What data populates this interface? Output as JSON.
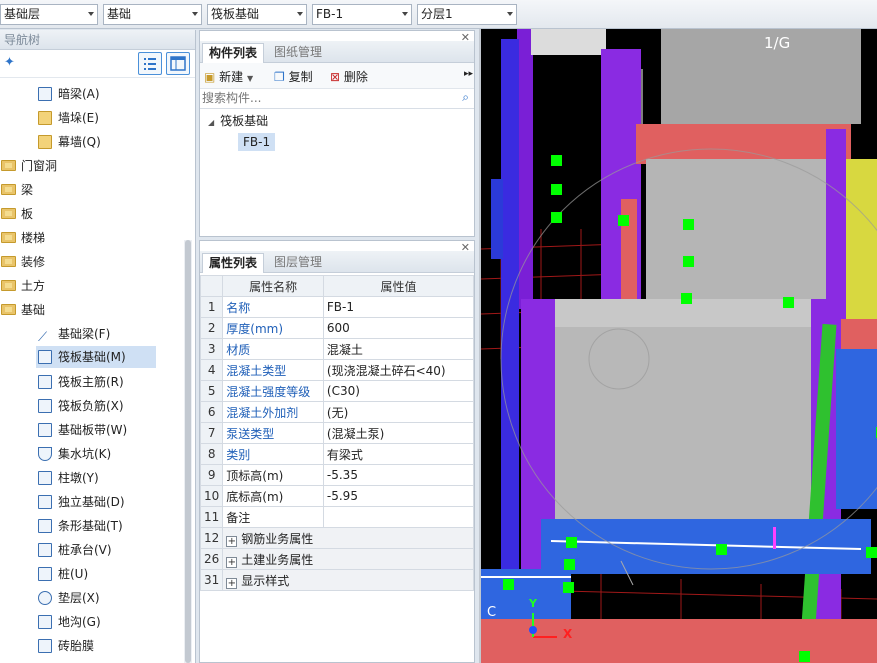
{
  "toolbar": {
    "floor": "基础层",
    "category": "基础",
    "type": "筏板基础",
    "component": "FB-1",
    "layer": "分层1"
  },
  "nav": {
    "title": "导航树",
    "items": [
      {
        "label": "暗梁(A)",
        "icon": "dark-beam-icon"
      },
      {
        "label": "墙垛(E)",
        "icon": "wall-pier-icon"
      },
      {
        "label": "幕墙(Q)",
        "icon": "curtain-wall-icon"
      },
      {
        "label": "门窗洞",
        "icon": "folder-icon"
      },
      {
        "label": "梁",
        "icon": "folder-icon"
      },
      {
        "label": "板",
        "icon": "folder-icon"
      },
      {
        "label": "楼梯",
        "icon": "folder-icon"
      },
      {
        "label": "装修",
        "icon": "folder-icon"
      },
      {
        "label": "土方",
        "icon": "folder-icon"
      },
      {
        "label": "基础",
        "icon": "folder-open-icon"
      },
      {
        "label": "基础梁(F)",
        "icon": "foundation-beam-icon"
      },
      {
        "label": "筏板基础(M)",
        "icon": "raft-foundation-icon"
      },
      {
        "label": "筏板主筋(R)",
        "icon": "raft-main-rebar-icon"
      },
      {
        "label": "筏板负筋(X)",
        "icon": "raft-negative-rebar-icon"
      },
      {
        "label": "基础板带(W)",
        "icon": "foundation-strip-icon"
      },
      {
        "label": "集水坑(K)",
        "icon": "sump-pit-icon"
      },
      {
        "label": "柱墩(Y)",
        "icon": "column-pier-icon"
      },
      {
        "label": "独立基础(D)",
        "icon": "isolated-footing-icon"
      },
      {
        "label": "条形基础(T)",
        "icon": "strip-footing-icon"
      },
      {
        "label": "桩承台(V)",
        "icon": "pile-cap-icon"
      },
      {
        "label": "桩(U)",
        "icon": "pile-icon"
      },
      {
        "label": "垫层(X)",
        "icon": "cushion-layer-icon"
      },
      {
        "label": "地沟(G)",
        "icon": "trench-icon"
      },
      {
        "label": "砖胎膜",
        "icon": "brick-mold-icon"
      }
    ]
  },
  "component_panel": {
    "tabs": [
      "构件列表",
      "图纸管理"
    ],
    "new_label": "新建",
    "copy_label": "复制",
    "delete_label": "删除",
    "search_placeholder": "搜索构件...",
    "tree_root": "筏板基础",
    "tree_child": "FB-1"
  },
  "property_panel": {
    "tabs": [
      "属性列表",
      "图层管理"
    ],
    "col_name": "属性名称",
    "col_value": "属性值",
    "rows": [
      {
        "n": "1",
        "name": "名称",
        "value": "FB-1",
        "blue": true
      },
      {
        "n": "2",
        "name": "厚度(mm)",
        "value": "600",
        "blue": true
      },
      {
        "n": "3",
        "name": "材质",
        "value": "混凝土",
        "blue": true
      },
      {
        "n": "4",
        "name": "混凝土类型",
        "value": "(现浇混凝土碎石<40)",
        "blue": true
      },
      {
        "n": "5",
        "name": "混凝土强度等级",
        "value": "(C30)",
        "blue": true
      },
      {
        "n": "6",
        "name": "混凝土外加剂",
        "value": "(无)",
        "blue": true
      },
      {
        "n": "7",
        "name": "泵送类型",
        "value": "(混凝土泵)",
        "blue": true
      },
      {
        "n": "8",
        "name": "类别",
        "value": "有梁式",
        "blue": true
      },
      {
        "n": "9",
        "name": "顶标高(m)",
        "value": "-5.35",
        "blue": false
      },
      {
        "n": "10",
        "name": "底标高(m)",
        "value": "-5.95",
        "blue": false
      },
      {
        "n": "11",
        "name": "备注",
        "value": "",
        "blue": false
      }
    ],
    "groups": [
      {
        "n": "12",
        "name": "钢筋业务属性"
      },
      {
        "n": "26",
        "name": "土建业务属性"
      },
      {
        "n": "31",
        "name": "显示样式"
      }
    ]
  },
  "viewport": {
    "axis_label": "1/G",
    "corner_label": "C",
    "x_axis": "X",
    "y_axis": "Y"
  }
}
